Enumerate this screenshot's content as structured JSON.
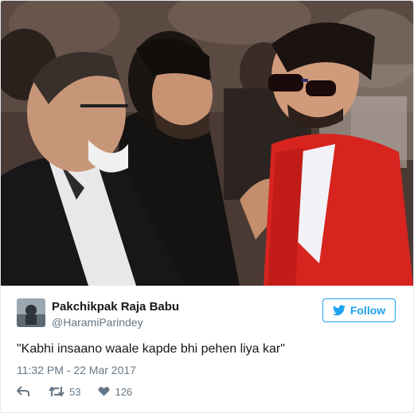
{
  "tweet": {
    "author_name": "Pakchikpak Raja Babu",
    "author_handle": "@HaramiParindey",
    "follow_label": "Follow",
    "text": "\"Kabhi insaano waale kapde bhi pehen liya kar\"",
    "timestamp": "11:32 PM - 22 Mar 2017",
    "retweet_count": "53",
    "like_count": "126"
  },
  "icons": {
    "follow": "twitter-bird-icon",
    "reply": "reply-icon",
    "retweet": "retweet-icon",
    "like": "heart-icon"
  },
  "colors": {
    "accent": "#1da1f2",
    "text": "#14171a",
    "muted": "#657786",
    "border": "#e1e8ed"
  }
}
